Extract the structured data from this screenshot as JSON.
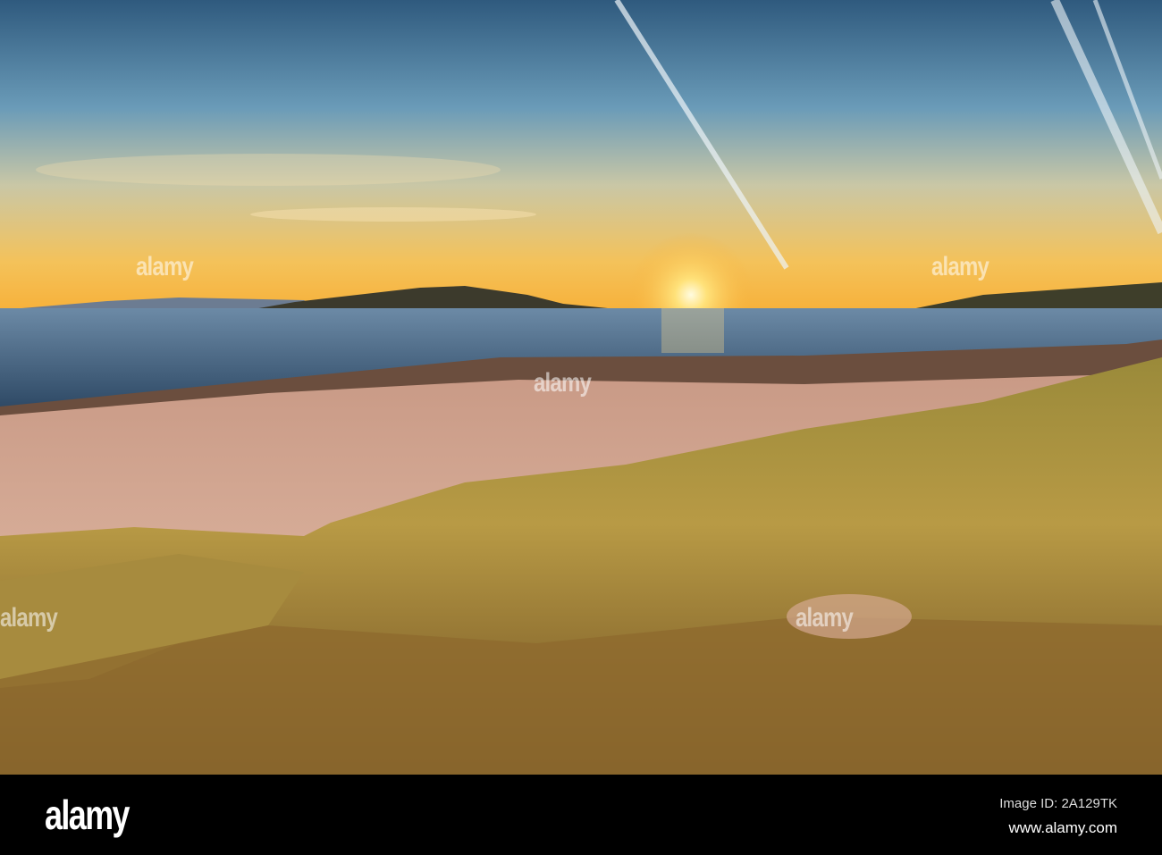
{
  "photo": {
    "subject": "Sunset over sandy beach with marram grass dunes",
    "watermark_text": "alamy"
  },
  "footer": {
    "logo": "alamy",
    "image_id": "Image ID: 2A129TK",
    "website": "www.alamy.com"
  }
}
